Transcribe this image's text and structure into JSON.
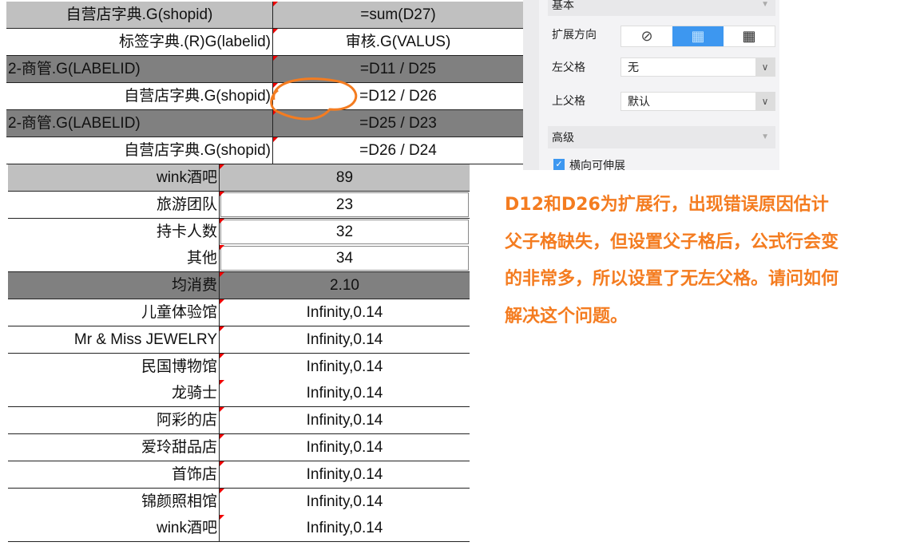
{
  "top_grid": {
    "rows": [
      {
        "c1": "自营店字典.G(shopid)",
        "c2": "=sum(D27)",
        "style": "lg",
        "align": "center"
      },
      {
        "c1": "标签字典.(R)G(labelid)",
        "c2": "审核.G(VALUS)",
        "style": "wh",
        "align": "right"
      },
      {
        "c1": "2-商管.G(LABELID)",
        "c2": "=D11 / D25",
        "style": "dg",
        "align": "left"
      },
      {
        "c1": "自营店字典.G(shopid)",
        "c2": "=D12 / D26",
        "style": "wh",
        "align": "right"
      },
      {
        "c1": "2-商管.G(LABELID)",
        "c2": "=D25 / D23",
        "style": "dg",
        "align": "left"
      },
      {
        "c1": "自营店字典.G(shopid)",
        "c2": "=D26 / D24",
        "style": "wh",
        "align": "right"
      }
    ]
  },
  "panel": {
    "basic": "基本",
    "expand_direction": "扩展方向",
    "left_parent": "左父格",
    "left_parent_value": "无",
    "top_parent": "上父格",
    "top_parent_value": "默认",
    "advanced": "高级",
    "horizontal_expand": "横向可伸展",
    "selected_direction": "vertical"
  },
  "bottom_grid": {
    "rows": [
      {
        "c1": "wink酒吧",
        "c2": "89",
        "style": "lg"
      },
      {
        "c1": "旅游团队",
        "c2": "23",
        "style": "wh",
        "boxed": true
      },
      {
        "c1": "持卡人数",
        "c2": "32",
        "style": "wh",
        "boxed": true
      },
      {
        "c1": "其他",
        "c2": "34",
        "style": "wh",
        "boxed": true
      },
      {
        "c1": "均消费",
        "c2": "2.10",
        "style": "dg"
      },
      {
        "c1": "儿童体验馆",
        "c2": "Infinity,0.14",
        "style": "wh"
      },
      {
        "c1": "Mr & Miss JEWELRY",
        "c2": "Infinity,0.14",
        "style": "wh"
      },
      {
        "c1": "民国博物馆",
        "c2": "Infinity,0.14",
        "style": "wh"
      },
      {
        "c1": "龙骑士",
        "c2": "Infinity,0.14",
        "style": "wh"
      },
      {
        "c1": "阿彩的店",
        "c2": "Infinity,0.14",
        "style": "wh"
      },
      {
        "c1": "爱玲甜品店",
        "c2": "Infinity,0.14",
        "style": "wh"
      },
      {
        "c1": "首饰店",
        "c2": "Infinity,0.14",
        "style": "wh"
      },
      {
        "c1": "锦颜照相馆",
        "c2": "Infinity,0.14",
        "style": "wh"
      },
      {
        "c1": "wink酒吧",
        "c2": "Infinity,0.14",
        "style": "wh"
      }
    ]
  },
  "note": "D12和D26为扩展行，出现错误原因估计父子格缺失，但设置父子格后，公式行会变的非常多，所以设置了无左父格。请问如何解决这个问题。",
  "colors": {
    "note": "#f47c20",
    "highlight_circle": "#f47c20",
    "accent": "#3d97f0"
  }
}
